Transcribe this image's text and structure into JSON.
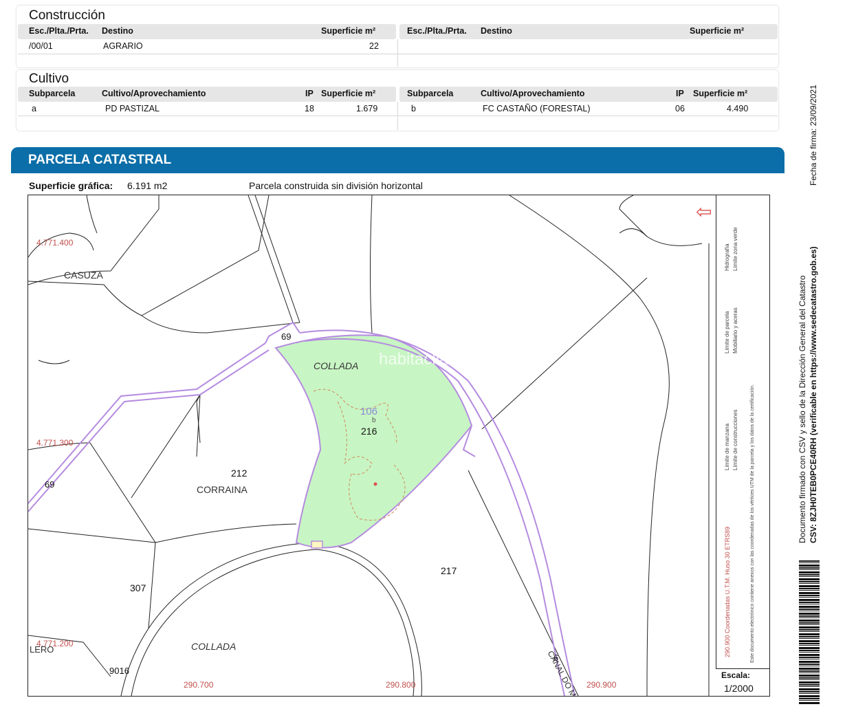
{
  "construccion": {
    "title": "Construcción",
    "headers": [
      "Esc./Plta./Prta.",
      "Destino",
      "Superficie m²"
    ],
    "rows": [
      {
        "esc": "/00/01",
        "destino": "AGRARIO",
        "superficie": "22"
      }
    ]
  },
  "cultivo": {
    "title": "Cultivo",
    "headers": [
      "Subparcela",
      "Cultivo/Aprovechamiento",
      "IP",
      "Superficie m²"
    ],
    "rows": [
      {
        "sub": "a",
        "cultivo": "PD PASTIZAL",
        "ip": "18",
        "superficie": "1.679"
      },
      {
        "sub": "b",
        "cultivo": "FC CASTAÑO (FORESTAL)",
        "ip": "06",
        "superficie": "4.490"
      }
    ]
  },
  "parcela": {
    "title": "PARCELA CATASTRAL",
    "superficie_label": "Superficie gráfica:",
    "superficie_value": "6.191 m2",
    "descripcion": "Parcela construida sin división horizontal"
  },
  "map": {
    "coords_y": [
      "4.771.400",
      "4.771.300",
      "4.771.200"
    ],
    "coords_x": [
      "290.700",
      "290.800",
      "290.900"
    ],
    "labels": {
      "casuza": "CASUZA",
      "collada_top": "COLLADA",
      "collada_bottom": "COLLADA",
      "corraina": "CORRAINA",
      "lero": "LERO",
      "canal": "CANAL DO M..."
    },
    "parcel_numbers": {
      "p69a": "69",
      "p69b": "69",
      "p69c": "6",
      "p106": "106",
      "p216": "216",
      "p212": "212",
      "p217": "217",
      "p307": "307",
      "p9016": "9016",
      "sub_b": "b"
    },
    "watermark": "habitaclia",
    "legend": [
      "Límite de manzana",
      "Límite de construcciones",
      "Límite de parcela",
      "Mobiliario y aceras",
      "Hidrografía",
      "Límite zona verde"
    ],
    "legend_note": "290.900 Coordenadas U.T.M. Huso 30 ETRS89",
    "legend_disclaimer": "Este documento electrónico contiene anexos con las coordenadas de los vértices UTM de la parcela y los datos de la certificación.",
    "escala_label": "Escala:",
    "escala_value": "1/2000",
    "colors": {
      "parcel_fill": "#c8f5c4",
      "boundary_purple": "#b58be0",
      "coord_red": "#c0504d",
      "banner_blue": "#0b6ea8"
    }
  },
  "sidebar": {
    "line1": "Documento firmado con CSV y sello de la Dirección General del Catastro",
    "line2": "CSV: 8ZJH0TEB0PCE40RH (verificable en https://www.sedecatastro.gob.es)",
    "line3": "Fecha de firma: 23/09/2021"
  }
}
